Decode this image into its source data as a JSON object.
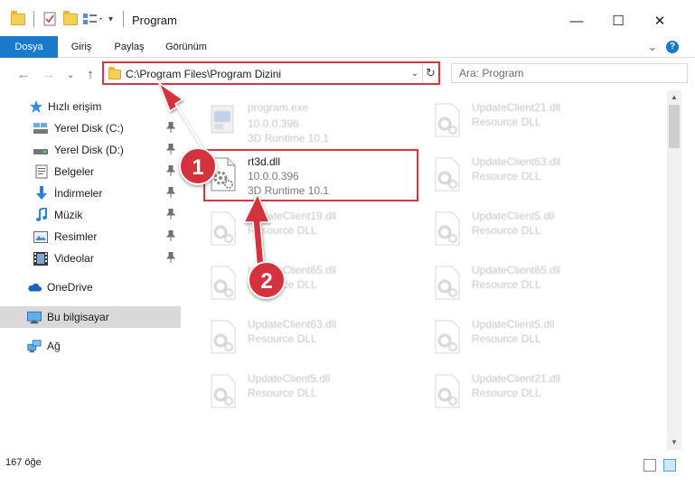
{
  "window": {
    "title": "Program",
    "controls": {
      "minimize": "—",
      "maximize": "☐",
      "close": "✕"
    }
  },
  "ribbon": {
    "tabs": [
      {
        "label": "Dosya",
        "active": true
      },
      {
        "label": "Giriş"
      },
      {
        "label": "Paylaş"
      },
      {
        "label": "Görünüm"
      }
    ],
    "expand": "⌄",
    "help": "?"
  },
  "nav": {
    "back": "←",
    "forward": "→",
    "recent": "⌄",
    "up": "↑",
    "address": "C:\\Program Files\\Program Dizini",
    "address_dropdown": "⌄",
    "refresh": "↻",
    "search_placeholder": "Ara: Program"
  },
  "sidebar": {
    "items": [
      {
        "label": "Hızlı erişim",
        "icon": "star-icon",
        "pinned": false
      },
      {
        "label": "Yerel Disk (C:)",
        "icon": "drive-icon",
        "pinned": true
      },
      {
        "label": "Yerel Disk (D:)",
        "icon": "drive-icon",
        "pinned": true
      },
      {
        "label": "Belgeler",
        "icon": "documents-icon",
        "pinned": true
      },
      {
        "label": "İndirmeler",
        "icon": "download-icon",
        "pinned": true
      },
      {
        "label": "Müzik",
        "icon": "music-icon",
        "pinned": true
      },
      {
        "label": "Resimler",
        "icon": "pictures-icon",
        "pinned": true
      },
      {
        "label": "Videolar",
        "icon": "video-icon",
        "pinned": true
      },
      {
        "label": "OneDrive",
        "icon": "cloud-icon",
        "pinned": false
      },
      {
        "label": "Bu bilgisayar",
        "icon": "computer-icon",
        "pinned": false,
        "selected": true
      },
      {
        "label": "Ağ",
        "icon": "network-icon",
        "pinned": false
      }
    ],
    "pin_glyph": "📌"
  },
  "files": {
    "left": [
      {
        "name": "program.exe",
        "line2": "10.0.0.396",
        "line3": "3D Runtime 10.1",
        "kind": "exe",
        "faded": true
      },
      {
        "name": "rt3d.dll",
        "line2": "10.0.0.396",
        "line3": "3D Runtime 10.1",
        "kind": "dll",
        "faded": false
      },
      {
        "name": "UpdateClient19.dll",
        "line2": "Resource DLL",
        "kind": "dll",
        "faded": true
      },
      {
        "name": "UpdateClient65.dll",
        "line2": "Resource DLL",
        "kind": "dll",
        "faded": true
      },
      {
        "name": "UpdateClient63.dll",
        "line2": "Resource DLL",
        "kind": "dll",
        "faded": true
      },
      {
        "name": "UpdateClient5.dll",
        "line2": "Resource DLL",
        "kind": "dll",
        "faded": true
      }
    ],
    "right": [
      {
        "name": "UpdateClient21.dll",
        "line2": "Resource DLL",
        "kind": "dll",
        "faded": true
      },
      {
        "name": "UpdateClient63.dll",
        "line2": "Resource DLL",
        "kind": "dll",
        "faded": true
      },
      {
        "name": "UpdateClient5.dll",
        "line2": "Resource DLL",
        "kind": "dll",
        "faded": true
      },
      {
        "name": "UpdateClient65.dll",
        "line2": "Resource DLL",
        "kind": "dll",
        "faded": true
      },
      {
        "name": "UpdateClient5.dll",
        "line2": "Resource DLL",
        "kind": "dll",
        "faded": true
      },
      {
        "name": "UpdateClient21.dll",
        "line2": "Resource DLL",
        "kind": "dll",
        "faded": true
      }
    ]
  },
  "status": {
    "count": "167 öğe"
  },
  "annotations": {
    "step1": "1",
    "step2": "2"
  },
  "colors": {
    "accent": "#1979ca",
    "highlight": "#d9343f",
    "badge": "#d6323e"
  }
}
